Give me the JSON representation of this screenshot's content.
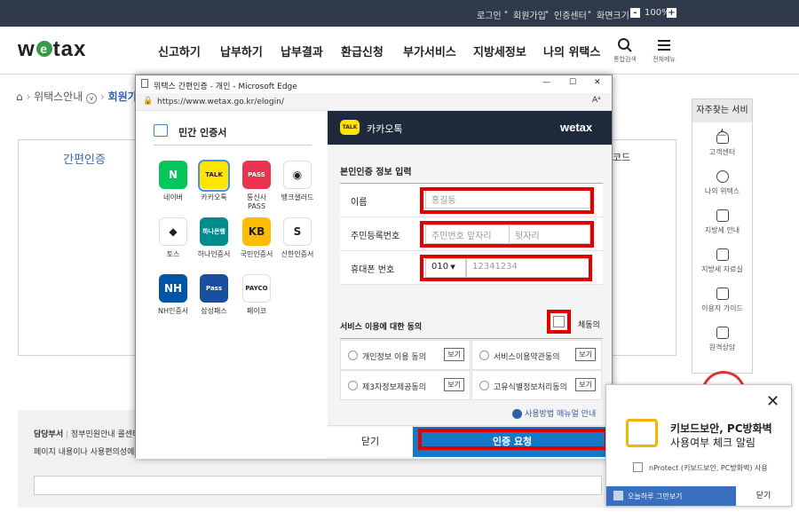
{
  "topbar": {
    "login": "로그인",
    "signup": "회원가입",
    "cert_center": "인증센터",
    "screen_size": "화면크기",
    "zoom_minus": "-",
    "zoom_value": "100%",
    "zoom_plus": "+"
  },
  "header": {
    "logo_prefix": "w",
    "logo_e": "e",
    "logo_suffix": "tax",
    "nav": [
      "신고하기",
      "납부하기",
      "납부결과",
      "환급신청",
      "부가서비스",
      "지방세정보",
      "나의 위택스"
    ],
    "search_label": "통합검색",
    "menu_label": "전체메뉴"
  },
  "breadcrumb": {
    "home_icon": "home-icon",
    "item1": "위택스안내",
    "item2": "회원가"
  },
  "background": {
    "tab_label": "간편인증",
    "right_partial": "코드",
    "footer_dept": "담당부서",
    "footer_dept_value": "정부민원안내 콜센터",
    "footer_text": "페이지 내용이나 사용편의성에"
  },
  "quick_services": {
    "title": "자주찾는 서비스",
    "items": [
      "고객센터",
      "나의 위택스",
      "지방세 안내",
      "지방세 자료실",
      "이용자 가이드",
      "원격상담"
    ]
  },
  "window": {
    "title": "위택스 간편인증 - 개인 - Microsoft Edge",
    "url": "https://www.wetax.go.kr/elogin/",
    "controls": [
      "—",
      "☐",
      "✕"
    ]
  },
  "left_pane": {
    "heading": "민간 인증서",
    "apps": [
      {
        "label": "네이버",
        "mark": "N",
        "color": "#03c75a"
      },
      {
        "label": "카카오톡",
        "mark": "TALK",
        "color": "#fee500"
      },
      {
        "label": "통신사PASS",
        "mark": "PASS",
        "color": "#e8344e"
      },
      {
        "label": "뱅크샐러드",
        "mark": "◉",
        "color": "#ffffff"
      },
      {
        "label": "토스",
        "mark": "◆",
        "color": "#ffffff"
      },
      {
        "label": "하나인증서",
        "mark": "하나은행",
        "color": "#008c8c"
      },
      {
        "label": "국민인증서",
        "mark": "KB",
        "color": "#ffbc00"
      },
      {
        "label": "신한인증서",
        "mark": "S",
        "color": "#ffffff"
      },
      {
        "label": "NH인증서",
        "mark": "NH",
        "color": "#0054a6"
      },
      {
        "label": "삼성패스",
        "mark": "Pass",
        "color": "#1a4fa0"
      },
      {
        "label": "페이코",
        "mark": "PAYCO",
        "color": "#ffffff"
      }
    ]
  },
  "right_pane": {
    "provider": "카카오톡",
    "provider_icon": "kakao-talk-icon",
    "brand": "wetax",
    "section_title": "본인인증 정보 입력",
    "name_label": "이름",
    "name_placeholder": "홍길동",
    "rrn_label": "주민등록번호",
    "rrn_front_placeholder": "주민번호 앞자리",
    "rrn_back_placeholder": "뒷자리",
    "phone_label": "휴대폰 번호",
    "phone_carrier": "010",
    "phone_placeholder": "12341234",
    "consent_title": "서비스 이용에 대한 동의",
    "consent_all": "체동의",
    "agreements": [
      {
        "label": "개인정보 이용 동의",
        "view": "보기"
      },
      {
        "label": "서비스이용약관동의",
        "view": "보기"
      },
      {
        "label": "제3자정보제공동의",
        "view": "보기"
      },
      {
        "label": "고유식별정보처리동의",
        "view": "보기"
      }
    ],
    "manual_link": "사용방법 매뉴얼 안내",
    "close_button": "닫기",
    "request_button": "인증 요청"
  },
  "keyboard_popup": {
    "title_line1": "키보드보안, PC방화벽",
    "title_line2": "사용여부 체크 알림",
    "check_label": "nProtect (키보드보안, PC방화벽) 사용",
    "dont_show": "오늘하루 그만보기",
    "close": "닫기"
  }
}
